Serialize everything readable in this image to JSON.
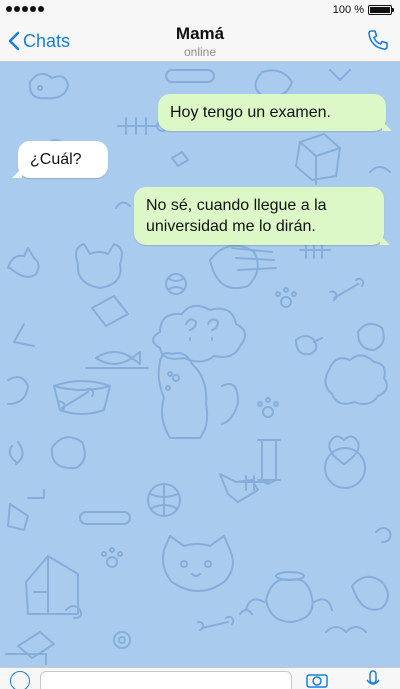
{
  "status_bar": {
    "signal_icon": "signal-dots-icon",
    "battery_percent": "100 %",
    "battery_icon": "battery-full-icon"
  },
  "header": {
    "back_label": "Chats",
    "back_icon": "chevron-left-icon",
    "title": "Mamá",
    "status": "online",
    "call_icon": "phone-icon"
  },
  "messages": [
    {
      "direction": "outgoing",
      "text": "Hoy tengo un examen."
    },
    {
      "direction": "incoming",
      "text": "¿Cuál?"
    },
    {
      "direction": "outgoing",
      "text": "No sé, cuando llegue a la universidad me lo dirán."
    }
  ],
  "input_bar": {
    "attach_icon": "upload-icon",
    "camera_icon": "camera-icon",
    "mic_icon": "microphone-icon"
  },
  "colors": {
    "accent": "#1a7ee0",
    "chat_background": "#a9cbee",
    "doodle_stroke": "#7fa9d8",
    "outgoing_bubble": "#dcf8c6",
    "incoming_bubble": "#ffffff"
  }
}
